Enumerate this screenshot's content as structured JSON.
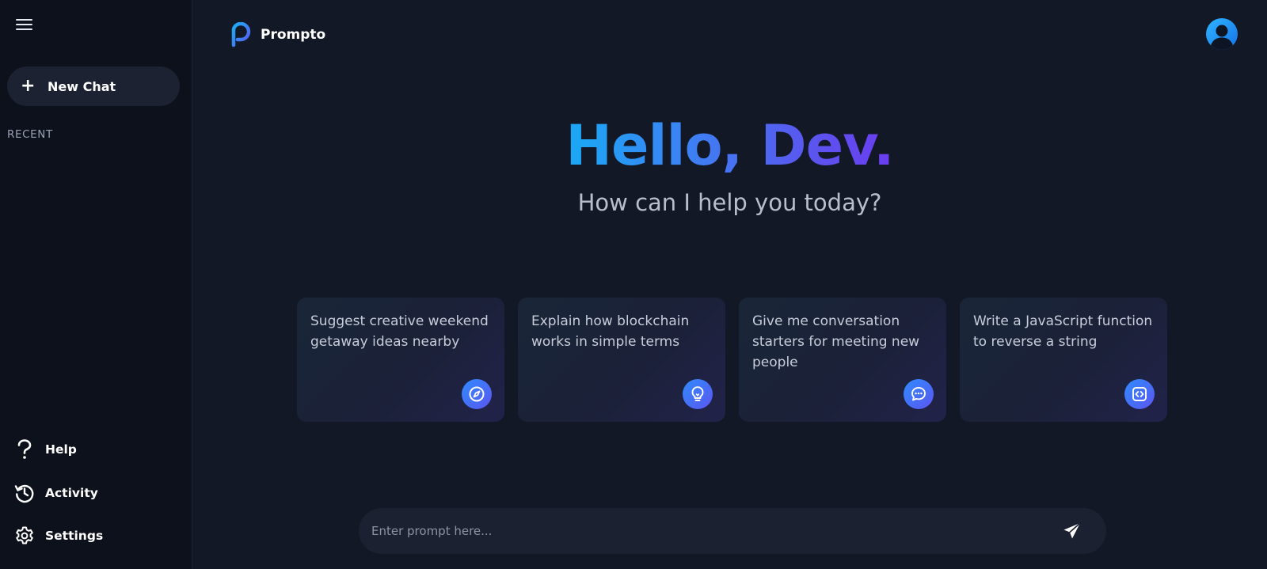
{
  "app": {
    "name": "Prompto"
  },
  "sidebar": {
    "new_chat_label": "New Chat",
    "recent_heading": "RECENT",
    "links": [
      {
        "label": "Help",
        "icon": "help-icon"
      },
      {
        "label": "Activity",
        "icon": "history-icon"
      },
      {
        "label": "Settings",
        "icon": "gear-icon"
      }
    ]
  },
  "hero": {
    "greeting": "Hello, Dev.",
    "subtitle": "How can I help you today?"
  },
  "cards": [
    {
      "text": "Suggest creative weekend getaway ideas nearby",
      "icon": "compass-icon"
    },
    {
      "text": "Explain how blockchain works in simple terms",
      "icon": "lightbulb-icon"
    },
    {
      "text": "Give me conversation starters for meeting new people",
      "icon": "chat-bubble-icon"
    },
    {
      "text": "Write a JavaScript function to reverse a string",
      "icon": "code-icon"
    }
  ],
  "prompt": {
    "placeholder": "Enter prompt here...",
    "send_icon": "send-icon"
  },
  "colors": {
    "background": "#131826",
    "sidebar": "#0c111b",
    "gradient_start": "#1aa9f5",
    "gradient_end": "#6b3cf0"
  }
}
